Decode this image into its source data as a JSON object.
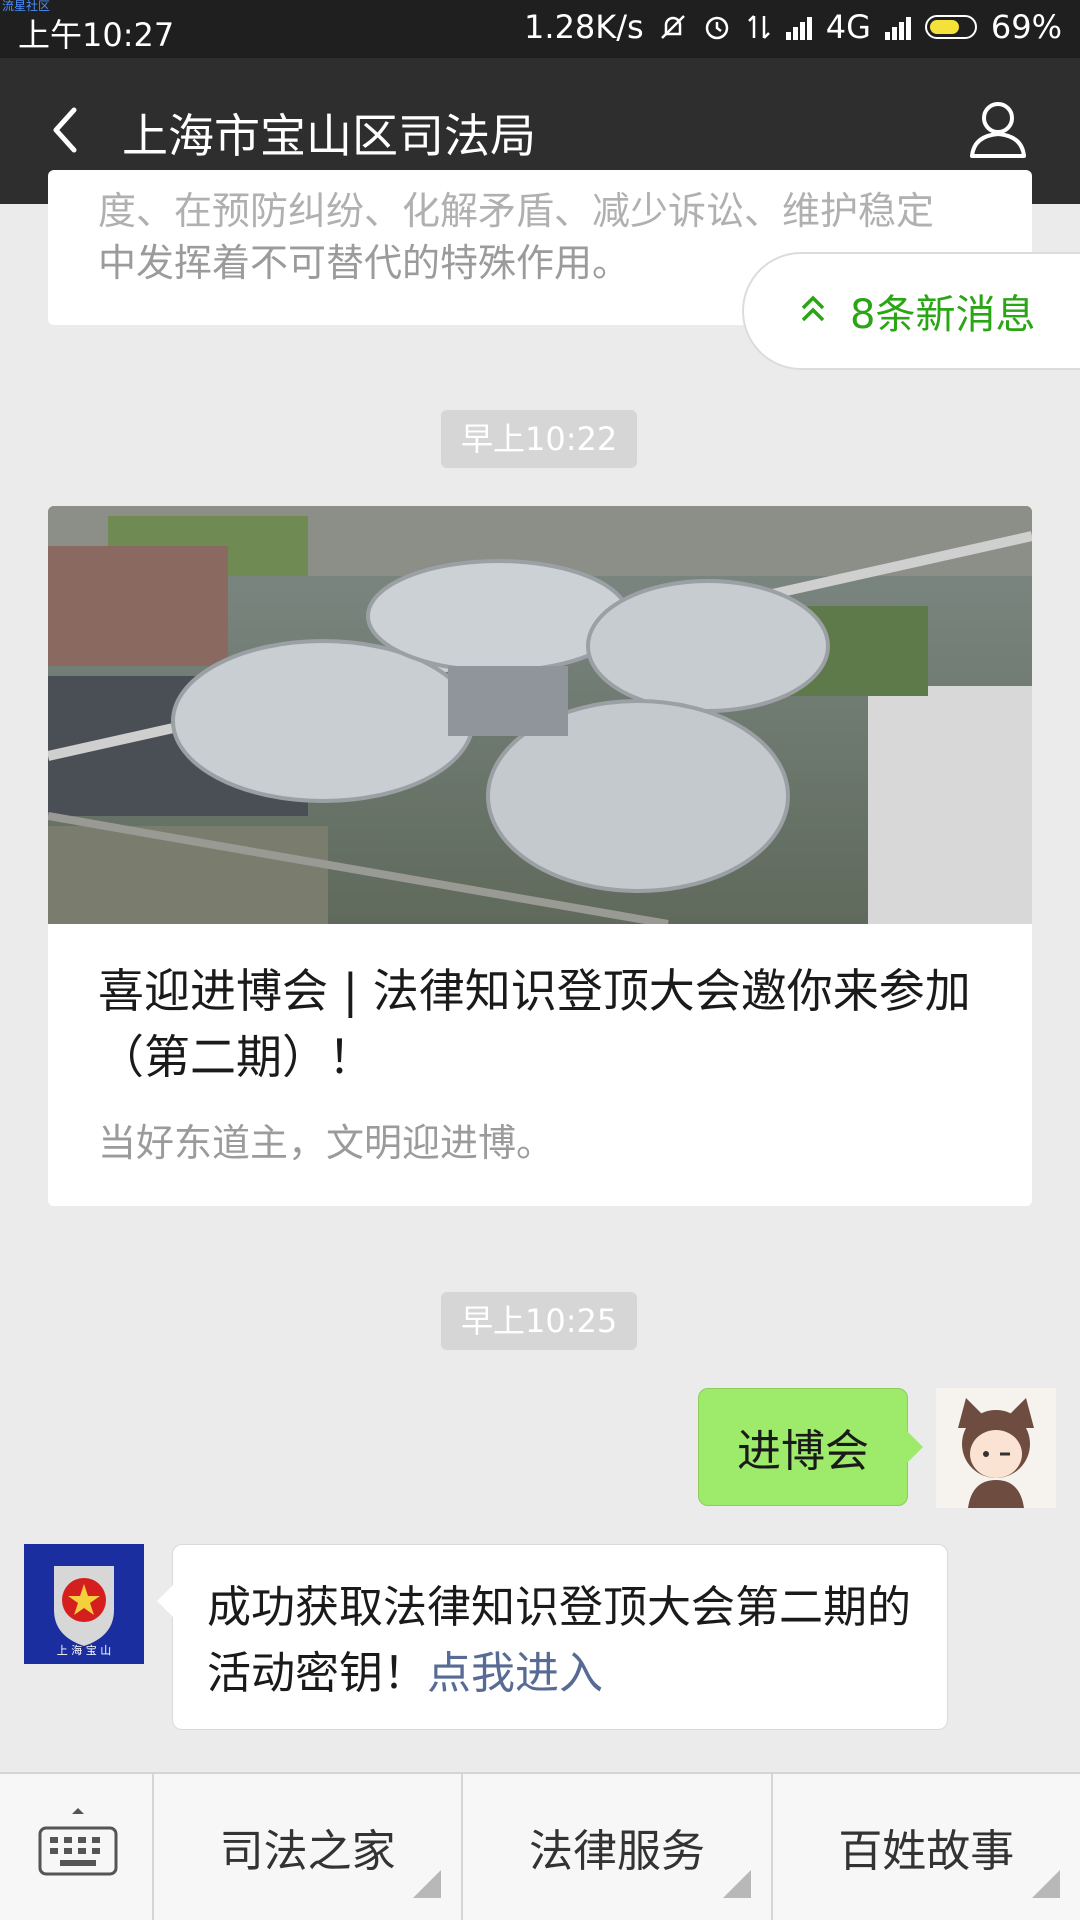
{
  "status_bar": {
    "watermark": "流星社区",
    "time": "上午10:27",
    "speed": "1.28K/s",
    "network": "4G",
    "battery": "69%",
    "battery_level": 0.69
  },
  "nav": {
    "title": "上海市宝山区司法局",
    "back_icon": "chevron-left-icon",
    "profile_icon": "user-icon"
  },
  "messages": {
    "prev_card_line1": "度、在预防纠纷、化解矛盾、减少诉讼、维护稳定",
    "prev_card_line2": "中发挥着不可替代的特殊作用。",
    "new_msg_label": "8条新消息",
    "time1": "早上10:22",
    "article": {
      "headline": "喜迎进博会 | 法律知识登顶大会邀你来参加（第二期）！",
      "digest": "当好东道主，文明迎进博。"
    },
    "time2": "早上10:25",
    "my_message": "进博会",
    "reply_text": "成功获取法律知识登顶大会第二期的活动密钥！",
    "reply_link": "点我进入",
    "bot_avatar_text": "上 海 宝 山"
  },
  "bottom_menu": {
    "keyboard_icon": "keyboard-icon",
    "items": [
      "司法之家",
      "法律服务",
      "百姓故事"
    ]
  },
  "colors": {
    "accent_green": "#2aa515",
    "bubble_green": "#9eea6a",
    "link": "#576b95"
  }
}
